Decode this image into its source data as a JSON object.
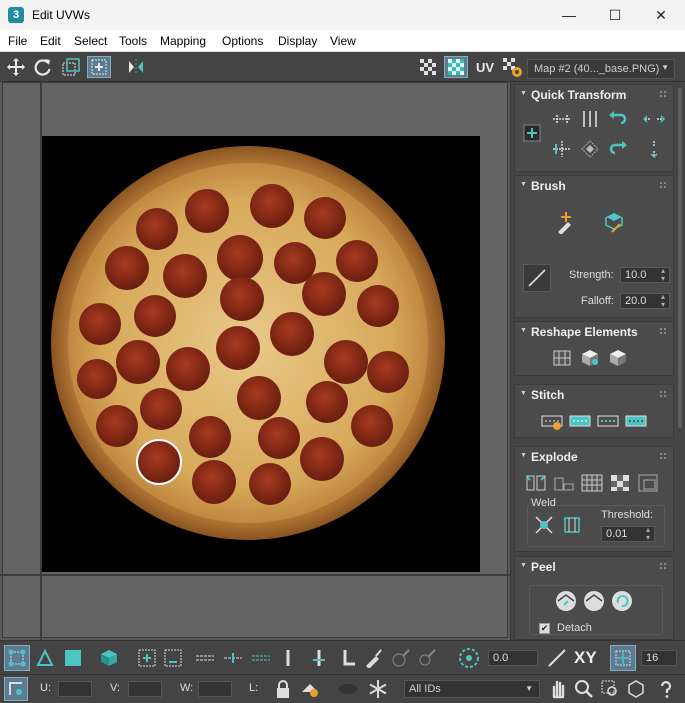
{
  "window": {
    "title": "Edit UVWs",
    "app_icon": "3",
    "minimize": "—",
    "maximize": "☐",
    "close": "✕"
  },
  "menu": [
    "File",
    "Edit",
    "Select",
    "Tools",
    "Mapping",
    "Options",
    "Display",
    "View"
  ],
  "toolbar": {
    "uv_label": "UV",
    "map_select": "Map #2 (40..._base.PNG)"
  },
  "panels": {
    "quick_transform": "Quick Transform",
    "brush": "Brush",
    "strength_label": "Strength:",
    "strength_value": "10.0",
    "falloff_label": "Falloff:",
    "falloff_value": "20.0",
    "reshape": "Reshape Elements",
    "stitch": "Stitch",
    "explode": "Explode",
    "weld_label": "Weld",
    "threshold_label": "Threshold:",
    "threshold_value": "0.01",
    "peel": "Peel",
    "detach_label": "Detach",
    "detach_checked": "✔"
  },
  "bottom": {
    "rotate_value": "0.0",
    "xy_label": "XY",
    "zoom_value": "16",
    "u_label": "U:",
    "v_label": "V:",
    "w_label": "W:",
    "l_label": "L:",
    "ids_select": "All IDs"
  },
  "colors": {
    "accent": "#3fc0c0",
    "background": "#444444",
    "highlight": "#5b7c92"
  }
}
